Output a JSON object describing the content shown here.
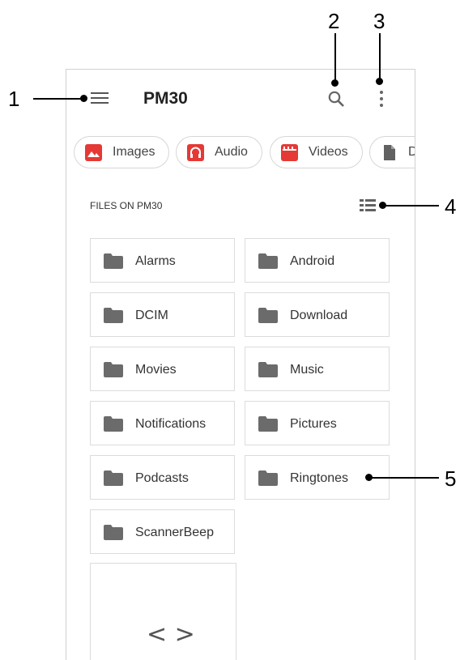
{
  "appbar": {
    "title": "PM30"
  },
  "icons": {
    "menu": "menu-icon",
    "search": "search-icon",
    "more": "more-vert-icon",
    "list": "list-view-icon",
    "folder": "folder-icon",
    "code": "code-icon"
  },
  "chips": [
    {
      "label": "Images",
      "color": "#e53935",
      "icon": "image-icon"
    },
    {
      "label": "Audio",
      "color": "#e53935",
      "icon": "headphones-icon"
    },
    {
      "label": "Videos",
      "color": "#e53935",
      "icon": "movie-icon"
    },
    {
      "label": "D",
      "color": "#616161",
      "icon": "document-icon"
    }
  ],
  "section": {
    "label": "FILES ON PM30"
  },
  "folders": [
    "Alarms",
    "Android",
    "DCIM",
    "Download",
    "Movies",
    "Music",
    "Notifications",
    "Pictures",
    "Podcasts",
    "Ringtones",
    "ScannerBeep"
  ],
  "code_glyph": "< >",
  "callouts": [
    "1",
    "2",
    "3",
    "4",
    "5"
  ]
}
